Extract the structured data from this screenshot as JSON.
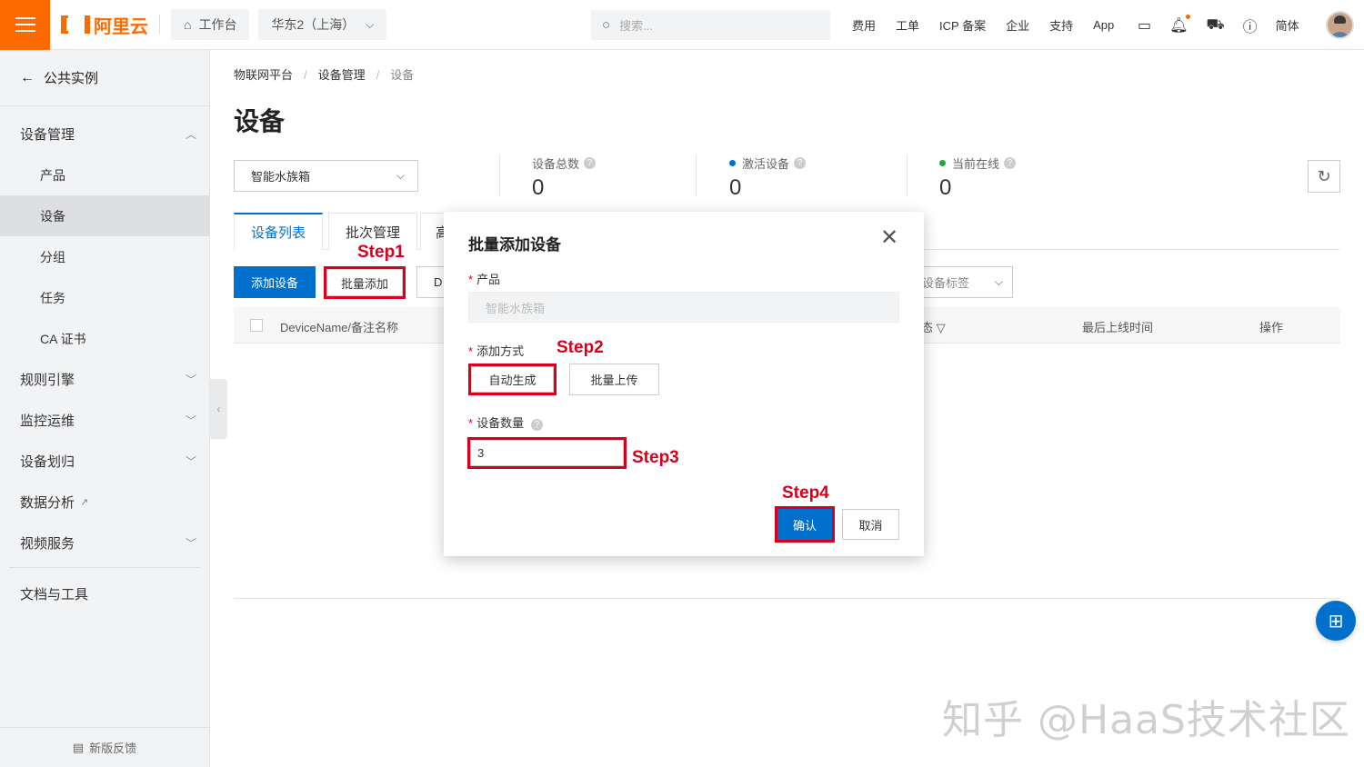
{
  "topbar": {
    "brand": "阿里云",
    "workbench": "工作台",
    "region": "华东2（上海）",
    "search_placeholder": "搜索...",
    "links": [
      "费用",
      "工单",
      "ICP 备案",
      "企业",
      "支持",
      "App"
    ],
    "language": "简体",
    "accent_color": "#ff6a00"
  },
  "sidebar": {
    "back_label": "公共实例",
    "section_device_mgmt": "设备管理",
    "sub_items": [
      "产品",
      "设备",
      "分组",
      "任务",
      "CA 证书"
    ],
    "active_sub": "设备",
    "rule_engine": "规则引擎",
    "monitor_ops": "监控运维",
    "device_assign": "设备划归",
    "data_analysis": "数据分析",
    "video_service": "视频服务",
    "docs_tools": "文档与工具",
    "feedback": "新版反馈"
  },
  "main": {
    "breadcrumb": [
      "物联网平台",
      "设备管理",
      "设备"
    ],
    "title": "设备",
    "product_select": "智能水族箱",
    "stats": [
      {
        "label": "设备总数",
        "value": "0"
      },
      {
        "label": "激活设备",
        "value": "0",
        "dot_color": "#0070cc"
      },
      {
        "label": "当前在线",
        "value": "0",
        "dot_color": "#1eaa39"
      }
    ],
    "tabs": [
      "设备列表",
      "批次管理",
      "高"
    ],
    "add_device": "添加设备",
    "batch_add": "批量添加",
    "partial_button": "D",
    "tag_select": "设备标签",
    "table_headers": {
      "name": "DeviceName/备注名称",
      "status": "态",
      "last_online": "最后上线时间",
      "actions": "操作"
    }
  },
  "modal": {
    "title": "批量添加设备",
    "product_label": "产品",
    "product_value": "智能水族箱",
    "method_label": "添加方式",
    "method_auto": "自动生成",
    "method_upload": "批量上传",
    "qty_label": "设备数量",
    "qty_value": "3",
    "confirm": "确认",
    "cancel": "取消"
  },
  "annotations": {
    "step1": "Step1",
    "step2": "Step2",
    "step3": "Step3",
    "step4": "Step4",
    "color": "#d9001b"
  },
  "watermark": "知乎 @HaaS技术社区"
}
